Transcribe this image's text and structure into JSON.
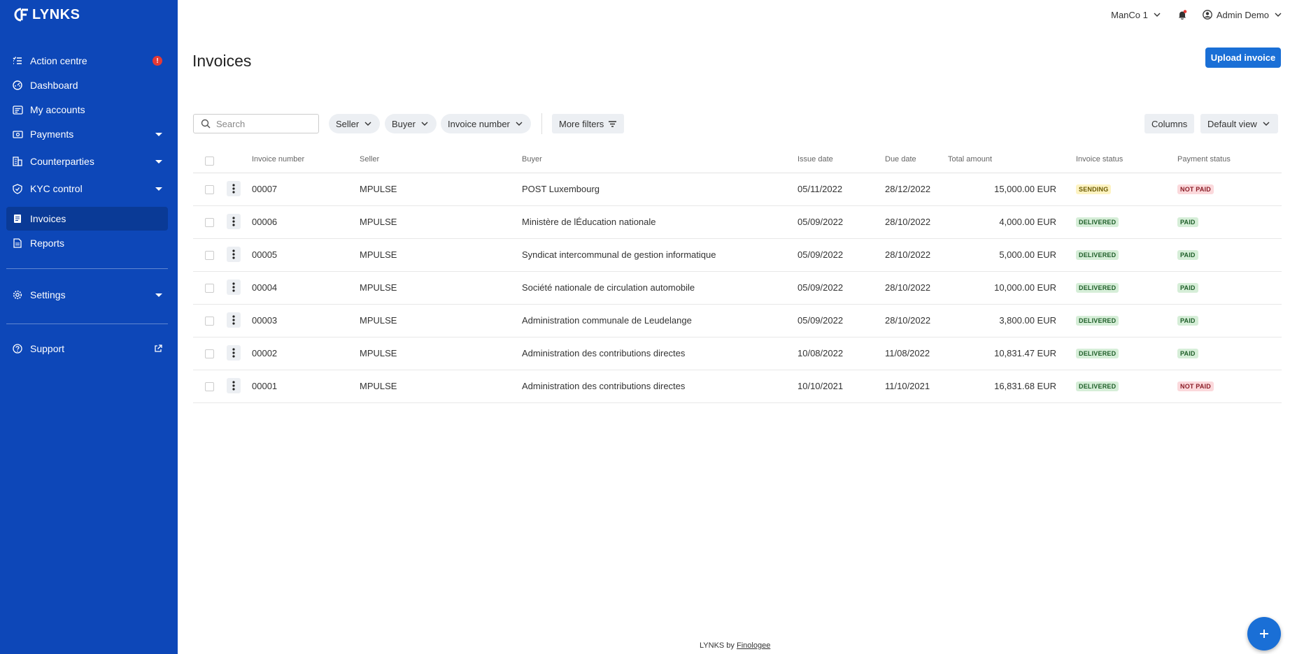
{
  "app": {
    "name": "LYNKS"
  },
  "sidebar": {
    "items": [
      {
        "label": "Action centre",
        "icon": "checklist-icon",
        "badge": "!"
      },
      {
        "label": "Dashboard",
        "icon": "dashboard-icon"
      },
      {
        "label": "My accounts",
        "icon": "accounts-icon"
      },
      {
        "label": "Payments",
        "icon": "payments-icon"
      },
      {
        "label": "Counterparties",
        "icon": "buildings-icon"
      },
      {
        "label": "KYC control",
        "icon": "shield-check-icon"
      },
      {
        "label": "Invoices",
        "icon": "invoice-icon",
        "active": true
      },
      {
        "label": "Reports",
        "icon": "report-icon"
      },
      {
        "label": "Settings",
        "icon": "gear-icon"
      },
      {
        "label": "Support",
        "icon": "help-icon"
      }
    ]
  },
  "topbar": {
    "company": "ManCo 1",
    "user": "Admin Demo"
  },
  "page": {
    "title": "Invoices",
    "upload_label": "Upload invoice"
  },
  "toolbar": {
    "search_placeholder": "Search",
    "filters": [
      "Seller",
      "Buyer",
      "Invoice number"
    ],
    "more_filters": "More filters",
    "columns": "Columns",
    "view": "Default view"
  },
  "table": {
    "headers": {
      "invoice_number": "Invoice number",
      "seller": "Seller",
      "buyer": "Buyer",
      "issue_date": "Issue date",
      "due_date": "Due date",
      "total_amount": "Total amount",
      "invoice_status": "Invoice status",
      "payment_status": "Payment status"
    },
    "rows": [
      {
        "number": "00007",
        "seller": "MPULSE",
        "buyer": "POST Luxembourg",
        "issue": "05/11/2022",
        "due": "28/12/2022",
        "amount": "15,000.00 EUR",
        "invoice_status": "SENDING",
        "payment_status": "NOT PAID"
      },
      {
        "number": "00006",
        "seller": "MPULSE",
        "buyer": "Ministère de lÉducation nationale",
        "issue": "05/09/2022",
        "due": "28/10/2022",
        "amount": "4,000.00 EUR",
        "invoice_status": "DELIVERED",
        "payment_status": "PAID"
      },
      {
        "number": "00005",
        "seller": "MPULSE",
        "buyer": "Syndicat intercommunal de gestion informatique",
        "issue": "05/09/2022",
        "due": "28/10/2022",
        "amount": "5,000.00 EUR",
        "invoice_status": "DELIVERED",
        "payment_status": "PAID"
      },
      {
        "number": "00004",
        "seller": "MPULSE",
        "buyer": "Société nationale de circulation automobile",
        "issue": "05/09/2022",
        "due": "28/10/2022",
        "amount": "10,000.00 EUR",
        "invoice_status": "DELIVERED",
        "payment_status": "PAID"
      },
      {
        "number": "00003",
        "seller": "MPULSE",
        "buyer": "Administration communale de Leudelange",
        "issue": "05/09/2022",
        "due": "28/10/2022",
        "amount": "3,800.00 EUR",
        "invoice_status": "DELIVERED",
        "payment_status": "PAID"
      },
      {
        "number": "00002",
        "seller": "MPULSE",
        "buyer": "Administration des contributions directes",
        "issue": "10/08/2022",
        "due": "11/08/2022",
        "amount": "10,831.47 EUR",
        "invoice_status": "DELIVERED",
        "payment_status": "PAID"
      },
      {
        "number": "00001",
        "seller": "MPULSE",
        "buyer": "Administration des contributions directes",
        "issue": "10/10/2021",
        "due": "11/10/2021",
        "amount": "16,831.68 EUR",
        "invoice_status": "DELIVERED",
        "payment_status": "NOT PAID"
      }
    ]
  },
  "status_colors": {
    "SENDING": {
      "bg": "#fdf3c2",
      "fg": "#6b5a00"
    },
    "DELIVERED": {
      "bg": "#d6eed8",
      "fg": "#1e5e28"
    },
    "PAID": {
      "bg": "#d6eed8",
      "fg": "#1e5e28"
    },
    "NOT PAID": {
      "bg": "#fbd9dc",
      "fg": "#8a1c26"
    }
  },
  "footer": {
    "prefix": "LYNKS by",
    "link": "Finologee"
  }
}
